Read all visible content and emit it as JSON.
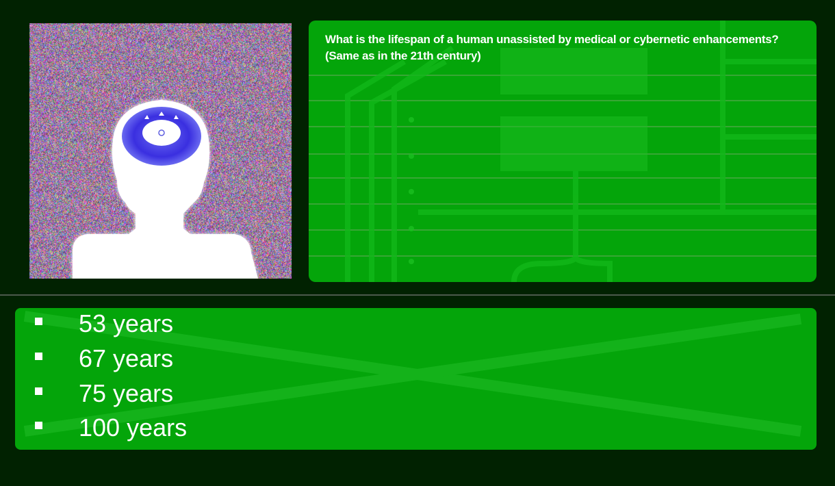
{
  "question": {
    "line1": "What is the lifespan of a human unassisted by medical or cybernetic enhancements?",
    "line2": "(Same as in the 21th century)"
  },
  "answers": [
    {
      "label": "53 years"
    },
    {
      "label": "67 years"
    },
    {
      "label": "75 years"
    },
    {
      "label": "100 years"
    }
  ],
  "colors": {
    "background": "#012201",
    "panel": "#04a50a",
    "text": "#ffffff",
    "eye_ring": "#3a2fe0"
  },
  "portrait": {
    "icon": "hologram-head-with-eye-icon"
  }
}
